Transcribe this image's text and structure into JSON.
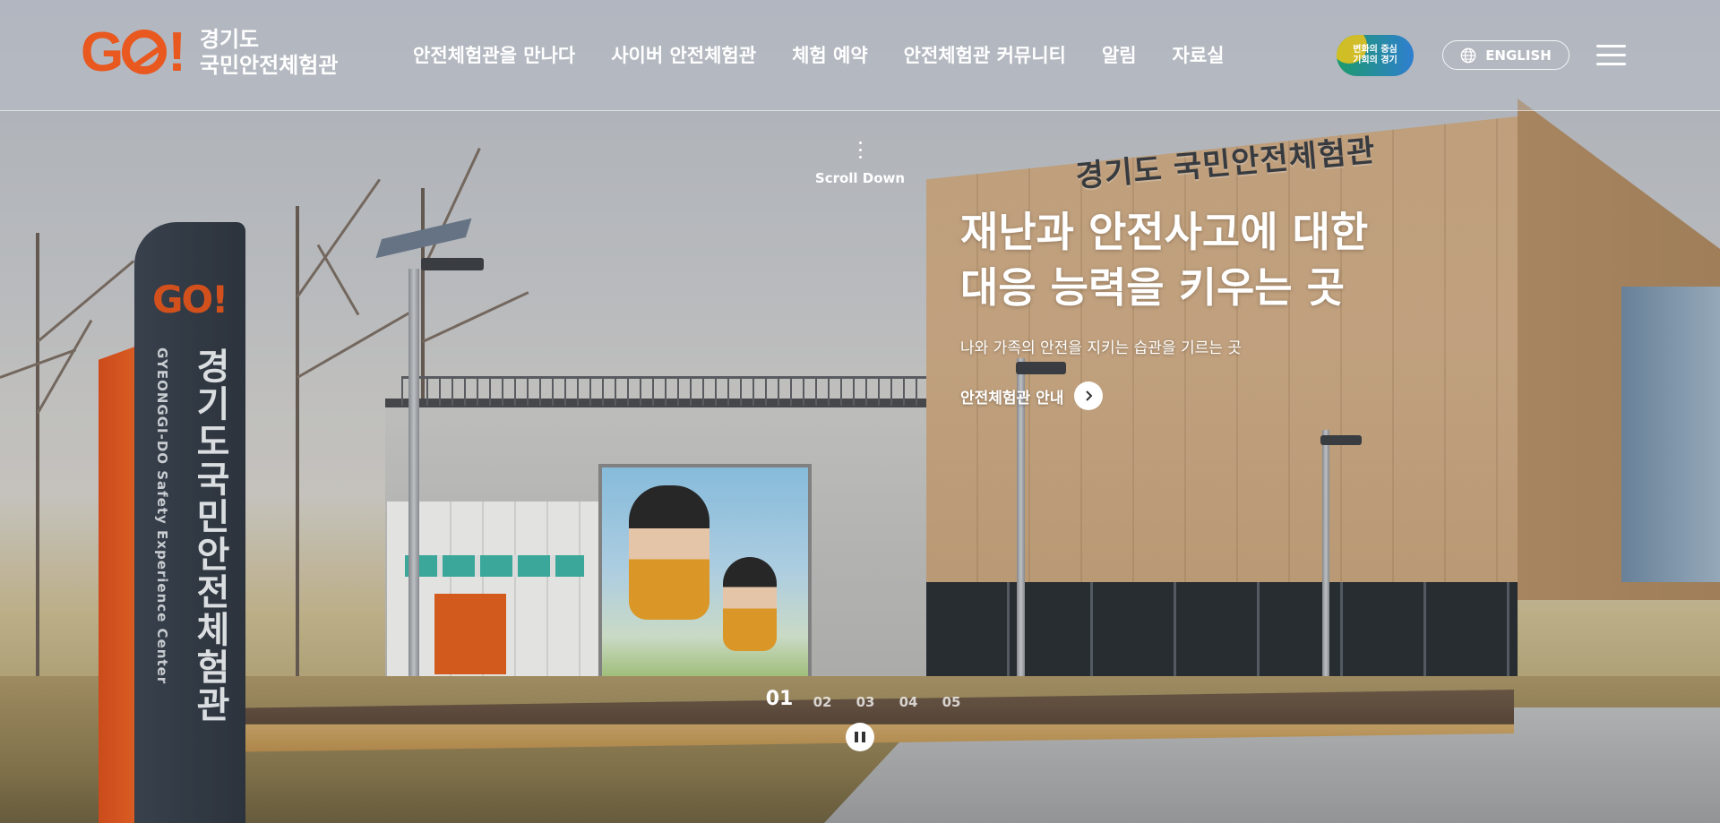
{
  "header": {
    "logo": {
      "mark": "GO!",
      "line1": "경기도",
      "line2": "국민안전체험관"
    },
    "nav": [
      {
        "label": "안전체험관을 만나다"
      },
      {
        "label": "사이버 안전체험관"
      },
      {
        "label": "체험 예약"
      },
      {
        "label": "안전체험관 커뮤니티"
      },
      {
        "label": "알림"
      },
      {
        "label": "자료실"
      }
    ],
    "badge": {
      "line1": "변화의 중심",
      "line2": "기회의 경기"
    },
    "lang_button": {
      "label": "ENGLISH",
      "icon": "globe-icon"
    },
    "menu_icon": "hamburger-menu-icon"
  },
  "scroll_down": {
    "label": "Scroll Down"
  },
  "hero": {
    "title_line1": "재난과 안전사고에 대한",
    "title_line2": "대응 능력을 키우는 곳",
    "subtitle": "나와 가족의 안전을 지키는 습관을 기르는 곳",
    "link_label": "안전체험관 안내",
    "link_icon": "chevron-right-icon"
  },
  "background": {
    "building_sign": "경기도 국민안전체험관",
    "pylon_logo": "GO!",
    "pylon_text": "경기도국민안전체험관",
    "pylon_en": "GYEONGGI-DO Safety Experience Center"
  },
  "pager": {
    "items": [
      "01",
      "02",
      "03",
      "04",
      "05"
    ],
    "active_index": 0,
    "pause_icon": "pause-icon"
  },
  "colors": {
    "brand_orange": "#e8581f",
    "white": "#ffffff"
  }
}
